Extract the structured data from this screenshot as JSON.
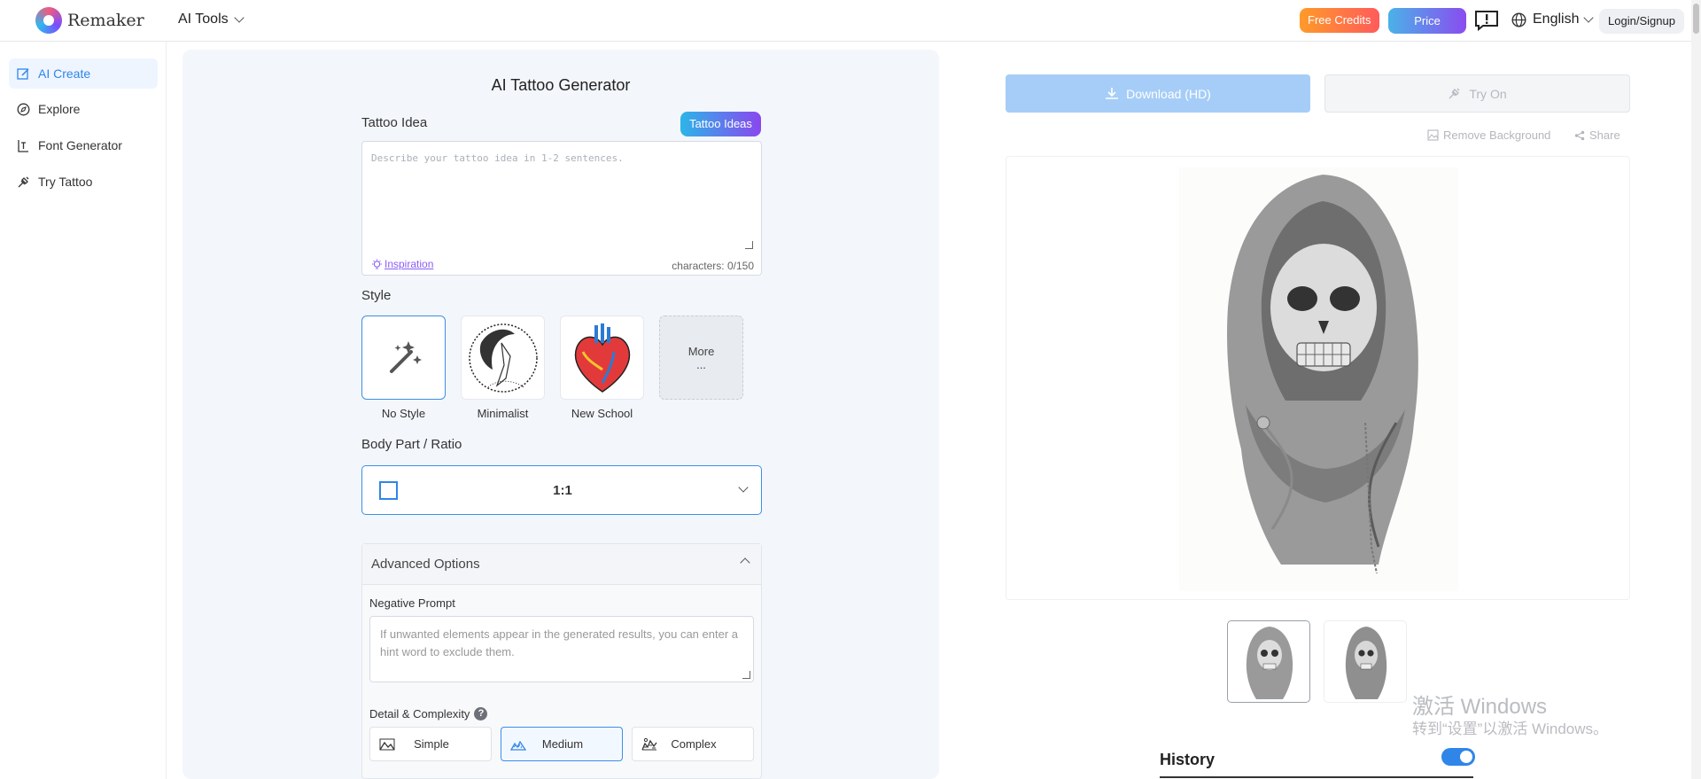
{
  "header": {
    "brand": "Remaker",
    "ai_tools": "AI Tools",
    "free_credits": "Free Credits",
    "price": "Price",
    "language": "English",
    "login": "Login/Signup"
  },
  "sidebar": {
    "items": [
      {
        "label": "AI Create",
        "icon": "edit-icon",
        "active": true
      },
      {
        "label": "Explore",
        "icon": "compass-icon",
        "active": false
      },
      {
        "label": "Font Generator",
        "icon": "font-icon",
        "active": false
      },
      {
        "label": "Try Tattoo",
        "icon": "tattoo-icon",
        "active": false
      }
    ]
  },
  "generator": {
    "title": "AI Tattoo Generator",
    "idea_label": "Tattoo Idea",
    "tattoo_ideas_button": "Tattoo Ideas",
    "idea_placeholder": "Describe your tattoo idea in 1-2 sentences.",
    "inspiration": "Inspiration",
    "char_count": "characters: 0/150",
    "style_label": "Style",
    "styles": [
      {
        "name": "No Style",
        "selected": true
      },
      {
        "name": "Minimalist",
        "selected": false
      },
      {
        "name": "New School",
        "selected": false
      }
    ],
    "more_label": "More",
    "more_dots": "...",
    "body_part_label": "Body Part / Ratio",
    "ratio_value": "1:1",
    "advanced_title": "Advanced Options",
    "negative_label": "Negative Prompt",
    "negative_placeholder": "If unwanted elements appear in the generated results, you can enter a hint word to exclude them.",
    "detail_label": "Detail & Complexity",
    "detail_help": "?",
    "complexity": [
      {
        "label": "Simple",
        "selected": false
      },
      {
        "label": "Medium",
        "selected": true
      },
      {
        "label": "Complex",
        "selected": false
      }
    ]
  },
  "result": {
    "download": "Download (HD)",
    "try_on": "Try On",
    "remove_bg": "Remove Background",
    "share": "Share",
    "history": "History",
    "history_toggle": true
  },
  "os_watermark": {
    "line1": "激活 Windows",
    "line2": "转到“设置”以激活 Windows。"
  },
  "colors": {
    "accent": "#2f86e8",
    "panel_bg": "#f3f6fb",
    "free_credits_gradient": [
      "#ff9a2a",
      "#ff5b5b"
    ],
    "price_gradient": [
      "#4ab2e8",
      "#8a4cf0"
    ]
  }
}
